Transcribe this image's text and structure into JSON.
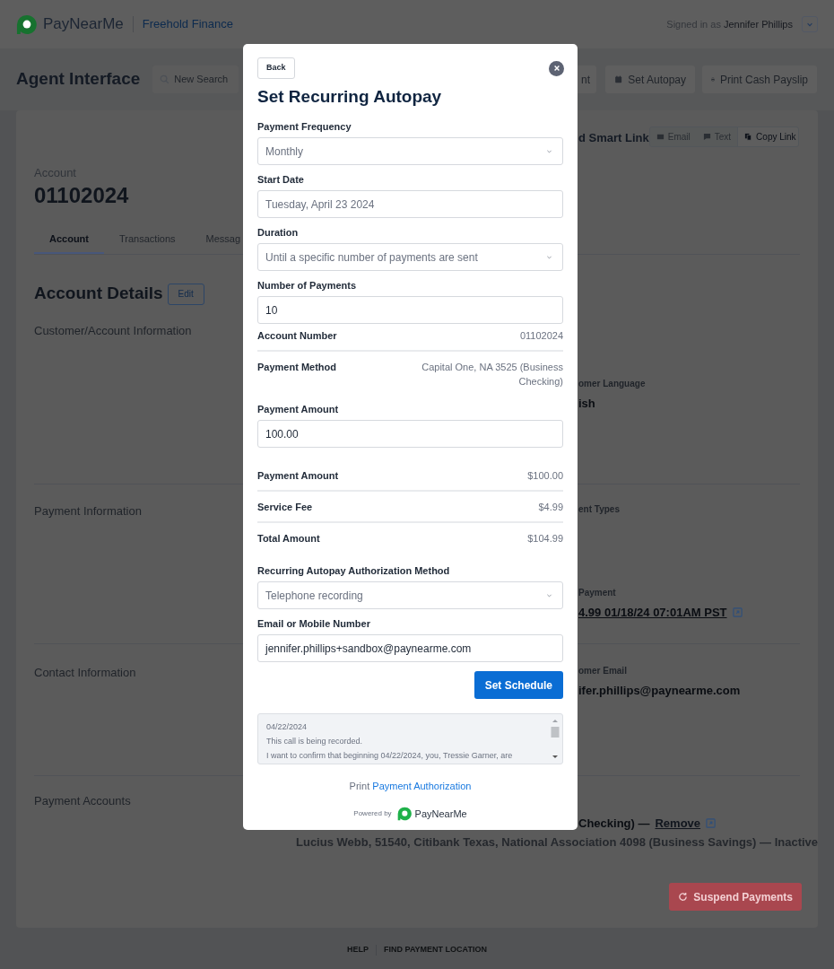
{
  "header": {
    "brand": "PayNearMe",
    "org": "Freehold Finance",
    "signed_in_label": "Signed in as",
    "user": "Jennifer Phillips"
  },
  "toolbar": {
    "title": "Agent Interface",
    "search_placeholder": "New Search",
    "buttons": [
      {
        "label": "nt",
        "kind": "plain"
      },
      {
        "label": "Set Autopay",
        "kind": "calendar"
      },
      {
        "label": "Print Cash Payslip",
        "kind": "print"
      }
    ]
  },
  "account": {
    "label": "Account",
    "number": "01102024"
  },
  "tabs": [
    {
      "label": "Account",
      "selected": true
    },
    {
      "label": "Transactions",
      "selected": false
    },
    {
      "label": "Messag",
      "selected": false
    }
  ],
  "smart_link": {
    "title": "d Smart Link",
    "buttons": [
      {
        "label": "Email",
        "kind": "email",
        "disabled": true
      },
      {
        "label": "Text",
        "kind": "text",
        "disabled": true
      },
      {
        "label": "Copy Link",
        "kind": "copy",
        "disabled": false
      }
    ]
  },
  "details": {
    "title": "Account Details",
    "edit": "Edit"
  },
  "sections": [
    {
      "title": "Customer/Account Information",
      "fields": [
        {
          "label": "omer Language",
          "value": "ish"
        }
      ]
    },
    {
      "title": "Payment Information",
      "fields": [
        {
          "label": "ent Types"
        },
        {
          "label": "Payment",
          "value": "4.99 01/18/24 07:01AM PST",
          "link": true
        }
      ]
    },
    {
      "title": "Contact Information",
      "fields": [
        {
          "label": "omer Email",
          "value": "ifer.phillips@paynearme.com"
        }
      ]
    },
    {
      "title": "Payment Accounts",
      "fields": [
        {
          "value": "Checking) —",
          "action": "Remove"
        }
      ]
    }
  ],
  "inactive_account": "Lucius Webb, 51540, Citibank Texas, National Association 4098 (Business Savings) — Inactive",
  "suspend_button": "Suspend Payments",
  "footer": [
    "HELP",
    "FIND PAYMENT LOCATION"
  ],
  "modal": {
    "back": "Back",
    "title": "Set Recurring Autopay",
    "items": [
      {
        "kind": "select",
        "label": "Payment Frequency",
        "value": "Monthly"
      },
      {
        "kind": "date",
        "label": "Start Date",
        "value": "Tuesday, April 23 2024"
      },
      {
        "kind": "select",
        "label": "Duration",
        "value": "Until a specific number of payments are sent"
      },
      {
        "kind": "input",
        "label": "Number of Payments",
        "value": "10"
      },
      {
        "kind": "row",
        "label": "Account Number",
        "value": "01102024",
        "divider": true
      },
      {
        "kind": "row",
        "label": "Payment Method",
        "value": "Capital One, NA 3525 (Business Checking)",
        "divider": false
      },
      {
        "kind": "input",
        "label": "Payment Amount",
        "value": "100.00"
      },
      {
        "kind": "row",
        "label": "Payment Amount",
        "value": "$100.00",
        "divider": true
      },
      {
        "kind": "row",
        "label": "Service Fee",
        "value": "$4.99",
        "divider": true
      },
      {
        "kind": "row",
        "label": "Total Amount",
        "value": "$104.99",
        "divider": false
      },
      {
        "kind": "select",
        "label": "Recurring Autopay Authorization Method",
        "value": "Telephone recording"
      },
      {
        "kind": "input",
        "label": "Email or Mobile Number",
        "value": "jennifer.phillips+sandbox@paynearme.com"
      }
    ],
    "submit": "Set Schedule",
    "script_lines": [
      "04/22/2024",
      "This call is being recorded.",
      "I want to confirm that beginning 04/22/2024, you, Tressie Garner, are"
    ],
    "print_prefix": "Print",
    "print_link": "Payment Authorization",
    "powered_by": "Powered by",
    "powered_brand": "PayNearMe"
  }
}
